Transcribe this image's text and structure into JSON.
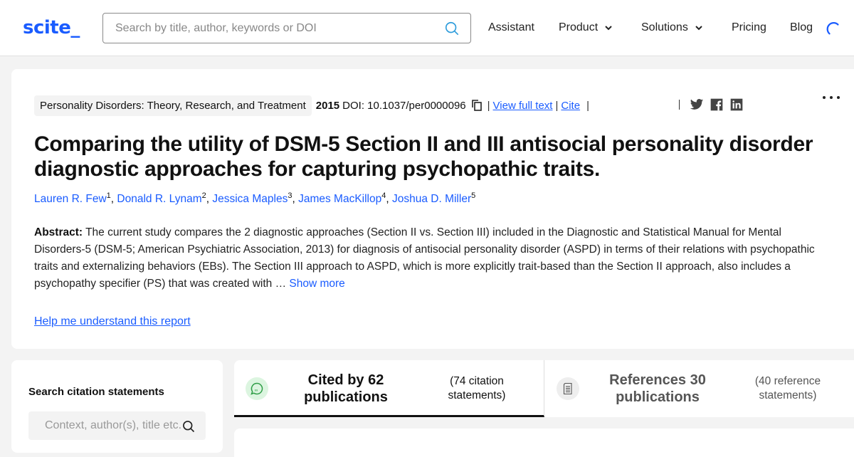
{
  "header": {
    "logo": "scite_",
    "search_placeholder": "Search by title, author, keywords or DOI",
    "nav": [
      {
        "label": "Assistant",
        "has_dropdown": false
      },
      {
        "label": "Product",
        "has_dropdown": true
      },
      {
        "label": "Solutions",
        "has_dropdown": true
      },
      {
        "label": "Pricing",
        "has_dropdown": false
      },
      {
        "label": "Blog",
        "has_dropdown": false
      }
    ],
    "loading_icon": "spinner-icon"
  },
  "article": {
    "journal": "Personality Disorders: Theory, Research, and Treatment",
    "year": "2015",
    "doi_label": "DOI:",
    "doi": "10.1037/per0000096",
    "separator": "|",
    "view_full_text": "View full text",
    "cite": "Cite",
    "social": [
      "twitter-icon",
      "facebook-icon",
      "linkedin-icon"
    ],
    "more_icon": "more-horizontal-icon",
    "title": "Comparing the utility of DSM-5 Section II and III antisocial personality disorder diagnostic approaches for capturing psychopathic traits.",
    "authors": [
      {
        "name": "Lauren R. Few",
        "sup": "1"
      },
      {
        "name": "Donald R. Lynam",
        "sup": "2"
      },
      {
        "name": "Jessica Maples",
        "sup": "3"
      },
      {
        "name": "James MacKillop",
        "sup": "4"
      },
      {
        "name": "Joshua D. Miller",
        "sup": "5"
      }
    ],
    "abstract_label": "Abstract:",
    "abstract_text": " The current study compares the 2 diagnostic approaches (Section II vs. Section III) included in the Diagnostic and Statistical Manual for Mental Disorders-5 (DSM-5; American Psychiatric Association, 2013) for diagnosis of antisocial personality disorder (ASPD) in terms of their relations with psychopathic traits and externalizing behaviors (EBs). The Section III approach to ASPD, which is more explicitly trait-based than the Section II approach, also includes a psychopathy specifier (PS) that was created with … ",
    "show_more": "Show more",
    "help_link": "Help me understand this report"
  },
  "citation_search": {
    "heading": "Search citation statements",
    "placeholder": "Context, author(s), title etc."
  },
  "tabs": [
    {
      "label": "Cited by 62 publications",
      "sub": "(74 citation statements)",
      "active": true,
      "icon": "quote-bubble-icon",
      "icon_bg": "#dcf5e0",
      "icon_color": "#2e9d46"
    },
    {
      "label": "References 30 publications",
      "sub": "(40 reference statements)",
      "active": false,
      "icon": "document-icon",
      "icon_bg": "#eeeeee",
      "icon_color": "#666666"
    }
  ],
  "colors": {
    "brand": "#1a5cff",
    "link": "#1a5cff",
    "text": "#111111",
    "page_bg": "#f3f3f3"
  }
}
